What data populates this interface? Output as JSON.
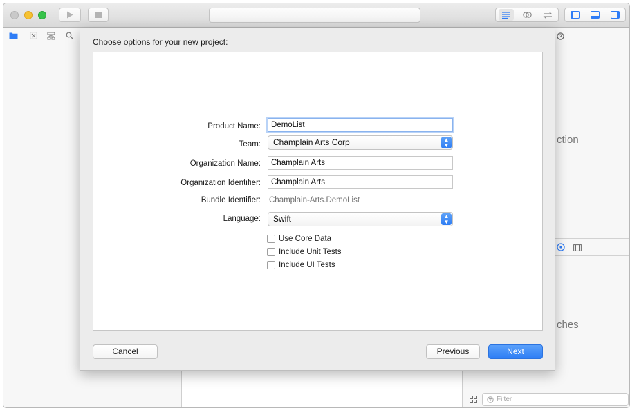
{
  "colors": {
    "accent": "#2e7cf6",
    "traffic_close": "#c9c9c9",
    "traffic_minimize": "#f6c232",
    "traffic_maximize": "#37c24a"
  },
  "toolbar": {
    "run_icon": "play-icon",
    "stop_icon": "stop-icon",
    "editor_modes": [
      "standard-editor-icon",
      "assistant-editor-icon",
      "version-editor-icon"
    ],
    "view_toggles": [
      "navigator-toggle-icon",
      "debug-area-toggle-icon",
      "utilities-toggle-icon"
    ]
  },
  "navigator": {
    "tab_icons": [
      "folder-icon",
      "source-control-icon",
      "hierarchy-icon",
      "find-icon"
    ]
  },
  "inspector": {
    "partial_text_top": "ction",
    "partial_text_bottom": "ches",
    "filter_placeholder": "Filter"
  },
  "sheet": {
    "title": "Choose options for your new project:",
    "form": {
      "product_name": {
        "label": "Product Name:",
        "value": "DemoList"
      },
      "team": {
        "label": "Team:",
        "value": "Champlain Arts Corp"
      },
      "organization_name": {
        "label": "Organization Name:",
        "value": "Champlain Arts"
      },
      "organization_identifier": {
        "label": "Organization Identifier:",
        "value": "Champlain Arts"
      },
      "bundle_identifier": {
        "label": "Bundle Identifier:",
        "value": "Champlain-Arts.DemoList"
      },
      "language": {
        "label": "Language:",
        "value": "Swift"
      }
    },
    "options": [
      {
        "label": "Use Core Data",
        "checked": false
      },
      {
        "label": "Include Unit Tests",
        "checked": false
      },
      {
        "label": "Include UI Tests",
        "checked": false
      }
    ],
    "buttons": {
      "cancel": "Cancel",
      "previous": "Previous",
      "next": "Next"
    }
  }
}
